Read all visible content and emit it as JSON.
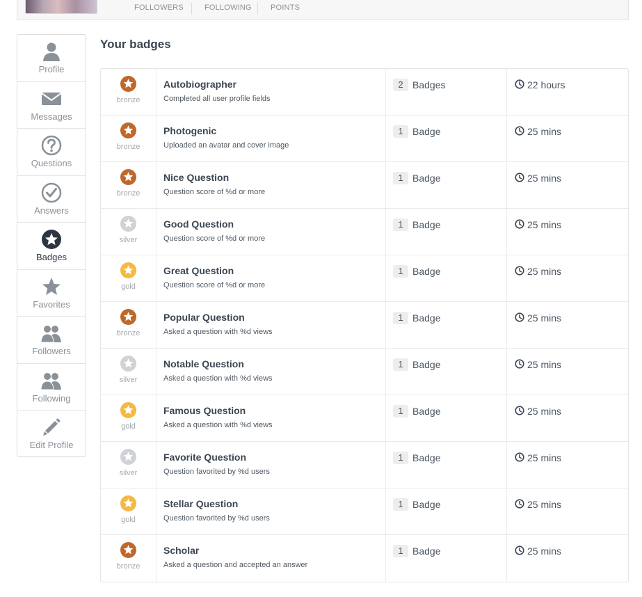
{
  "profile_stats": [
    "FOLLOWERS",
    "FOLLOWING",
    "POINTS"
  ],
  "sidebar": {
    "items": [
      {
        "label": "Profile",
        "icon": "user-icon"
      },
      {
        "label": "Messages",
        "icon": "envelope-icon"
      },
      {
        "label": "Questions",
        "icon": "question-circle-icon"
      },
      {
        "label": "Answers",
        "icon": "check-circle-icon"
      },
      {
        "label": "Badges",
        "icon": "star-circle-icon"
      },
      {
        "label": "Favorites",
        "icon": "star-icon"
      },
      {
        "label": "Followers",
        "icon": "users-icon"
      },
      {
        "label": "Following",
        "icon": "users-icon"
      },
      {
        "label": "Edit Profile",
        "icon": "pencil-icon"
      }
    ],
    "active": "Badges"
  },
  "page_title": "Your badges",
  "tier_colors": {
    "bronze": "#c0682b",
    "silver": "#d0d3d6",
    "gold": "#f5b942"
  },
  "badges": [
    {
      "tier": "bronze",
      "name": "Autobiographer",
      "desc": "Completed all user profile fields",
      "count": "2",
      "count_label": "Badges",
      "time": "22 hours"
    },
    {
      "tier": "bronze",
      "name": "Photogenic",
      "desc": "Uploaded an avatar and cover image",
      "count": "1",
      "count_label": "Badge",
      "time": "25 mins"
    },
    {
      "tier": "bronze",
      "name": "Nice Question",
      "desc": "Question score of %d or more",
      "count": "1",
      "count_label": "Badge",
      "time": "25 mins"
    },
    {
      "tier": "silver",
      "name": "Good Question",
      "desc": "Question score of %d or more",
      "count": "1",
      "count_label": "Badge",
      "time": "25 mins"
    },
    {
      "tier": "gold",
      "name": "Great Question",
      "desc": "Question score of %d or more",
      "count": "1",
      "count_label": "Badge",
      "time": "25 mins"
    },
    {
      "tier": "bronze",
      "name": "Popular Question",
      "desc": "Asked a question with %d views",
      "count": "1",
      "count_label": "Badge",
      "time": "25 mins"
    },
    {
      "tier": "silver",
      "name": "Notable Question",
      "desc": "Asked a question with %d views",
      "count": "1",
      "count_label": "Badge",
      "time": "25 mins"
    },
    {
      "tier": "gold",
      "name": "Famous Question",
      "desc": "Asked a question with %d views",
      "count": "1",
      "count_label": "Badge",
      "time": "25 mins"
    },
    {
      "tier": "silver",
      "name": "Favorite Question",
      "desc": "Question favorited by %d users",
      "count": "1",
      "count_label": "Badge",
      "time": "25 mins"
    },
    {
      "tier": "gold",
      "name": "Stellar Question",
      "desc": "Question favorited by %d users",
      "count": "1",
      "count_label": "Badge",
      "time": "25 mins"
    },
    {
      "tier": "bronze",
      "name": "Scholar",
      "desc": "Asked a question and accepted an answer",
      "count": "1",
      "count_label": "Badge",
      "time": "25 mins"
    }
  ]
}
